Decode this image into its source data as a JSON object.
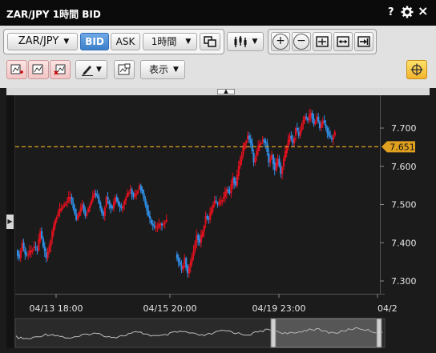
{
  "window": {
    "title": "ZAR/JPY 1時間 BID",
    "help_icon": "?",
    "settings_icon": "gear-icon",
    "close_icon": "×"
  },
  "toolbar": {
    "symbol": "ZAR/JPY",
    "bid_label": "BID",
    "ask_label": "ASK",
    "timeframe": "1時間",
    "display_label": "表示"
  },
  "chart_data": {
    "type": "candlestick",
    "y_ticks": [
      "7.700",
      "7.600",
      "7.500",
      "7.400",
      "7.300"
    ],
    "x_ticks": [
      "04/13 18:00",
      "04/15 20:00",
      "04/19 23:00",
      "04/2"
    ],
    "current_price": "7.651",
    "up_color": "#e0101e",
    "down_color": "#2f8fe6",
    "price_line_color": "#e0a020",
    "close_path": [
      7.38,
      7.36,
      7.4,
      7.37,
      7.37,
      7.38,
      7.39,
      7.38,
      7.43,
      7.39,
      7.36,
      7.39,
      7.43,
      7.46,
      7.48,
      7.49,
      7.5,
      7.51,
      7.52,
      7.49,
      7.46,
      7.48,
      7.5,
      7.47,
      7.49,
      7.51,
      7.53,
      7.52,
      7.49,
      7.47,
      7.52,
      7.5,
      7.49,
      7.52,
      7.5,
      7.49,
      7.51,
      7.53,
      7.54,
      7.52,
      7.53,
      7.55,
      7.53,
      7.5,
      7.47,
      7.45,
      7.44,
      7.44,
      7.45,
      7.45,
      7.46,
      null,
      7.37,
      7.35,
      7.33,
      7.36,
      7.32,
      7.35,
      7.38,
      7.42,
      7.4,
      7.43,
      7.47,
      7.46,
      7.49,
      7.51,
      7.5,
      7.51,
      7.52,
      7.54,
      7.53,
      7.57,
      7.55,
      7.6,
      7.63,
      7.66,
      7.68,
      7.66,
      7.61,
      7.64,
      7.66,
      7.67,
      7.66,
      7.61,
      7.63,
      7.59,
      7.62,
      7.58,
      7.62,
      7.65,
      7.68,
      7.66,
      7.7,
      7.68,
      7.71,
      7.73,
      7.72,
      7.74,
      7.71,
      7.73,
      7.7,
      7.72,
      7.7,
      7.68,
      7.67,
      7.69
    ],
    "navigator_label": "history overview"
  }
}
